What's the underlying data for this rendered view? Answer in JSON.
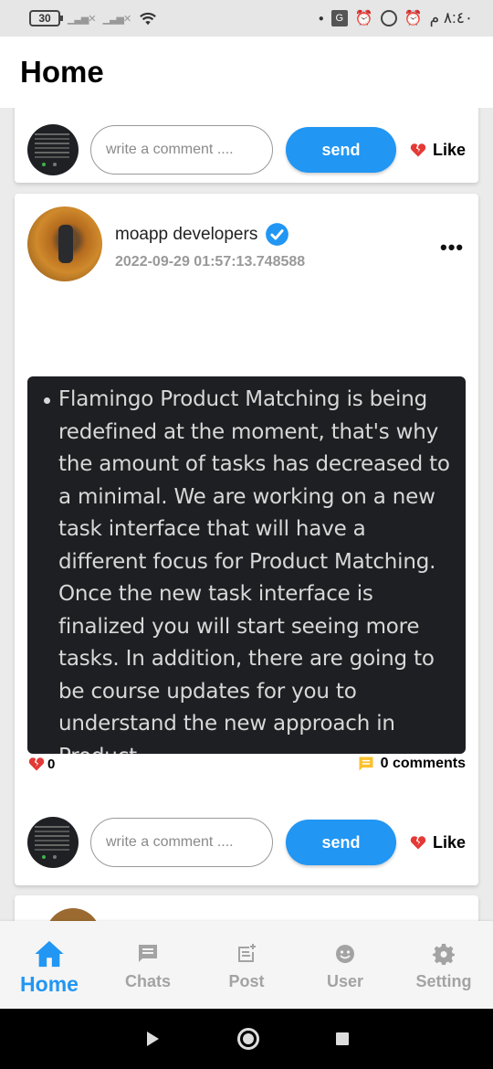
{
  "status_bar": {
    "battery": "30",
    "time": "٨:٤٠ م"
  },
  "app_bar": {
    "title": "Home"
  },
  "comment_placeholder": "write a comment ....",
  "send_label": "send",
  "like_label": "Like",
  "post": {
    "author": "moapp developers",
    "timestamp": "2022-09-29 01:57:13.748588",
    "body": "Flamingo Product Matching is being redefined at the moment, that's why the amount of tasks has decreased to a minimal. We are working on a new task interface that will have a different focus for Product Matching. Once the new task interface is finalized you will start seeing more tasks. In addition, there are going to be course updates for you to understand the new approach in Product",
    "likes": "0",
    "comments": "0 comments"
  },
  "bottom_nav": {
    "items": [
      {
        "label": "Home",
        "icon": "home-icon",
        "active": true
      },
      {
        "label": "Chats",
        "icon": "chat-icon",
        "active": false
      },
      {
        "label": "Post",
        "icon": "post-add-icon",
        "active": false
      },
      {
        "label": "User",
        "icon": "user-face-icon",
        "active": false
      },
      {
        "label": "Setting",
        "icon": "gear-icon",
        "active": false
      }
    ]
  },
  "colors": {
    "accent": "#2196f3",
    "heart": "#e53935",
    "post_bg": "#1e1f22",
    "comment_icon": "#fbc02d"
  }
}
